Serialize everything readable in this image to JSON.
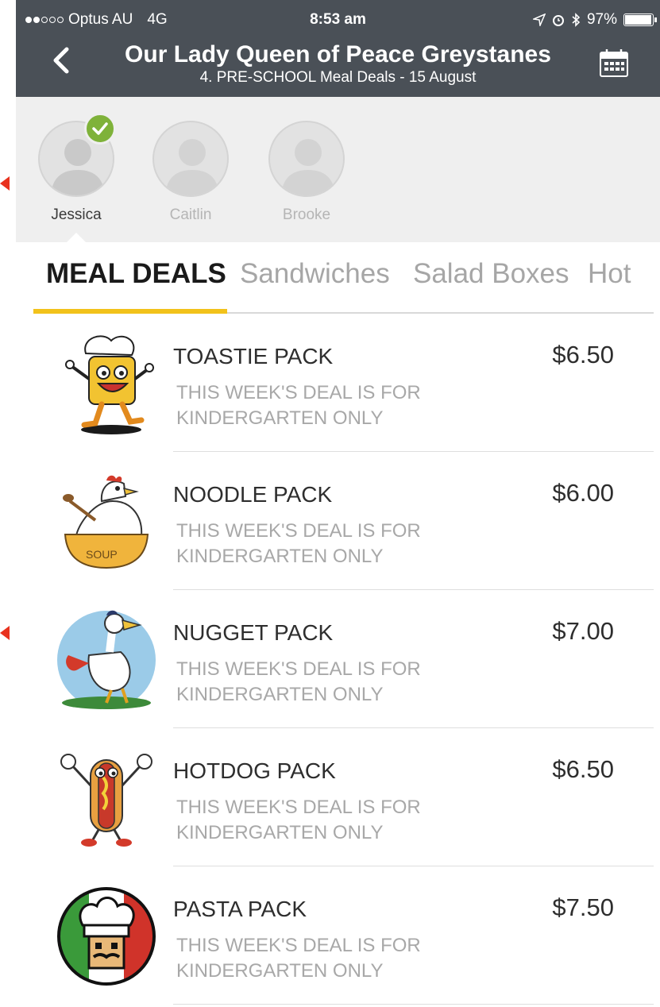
{
  "status_bar": {
    "carrier": "Optus AU",
    "network": "4G",
    "time": "8:53 am",
    "battery": "97%",
    "battery_level": 0.97
  },
  "header": {
    "title": "Our Lady Queen of Peace Greystanes",
    "subtitle": "4. PRE-SCHOOL Meal Deals - 15 August",
    "back_icon": "chevron-left-icon",
    "calendar_icon": "calendar-icon"
  },
  "children": [
    {
      "name": "Jessica",
      "selected": true
    },
    {
      "name": "Caitlin",
      "selected": false
    },
    {
      "name": "Brooke",
      "selected": false
    }
  ],
  "tabs": [
    {
      "label": "MEAL DEALS",
      "active": true
    },
    {
      "label": "Sandwiches",
      "active": false
    },
    {
      "label": "Salad Boxes",
      "active": false
    },
    {
      "label": "Hot",
      "active": false
    }
  ],
  "items": [
    {
      "name": "TOASTIE PACK",
      "price": "$6.50",
      "desc": "THIS WEEK'S DEAL IS FOR KINDERGARTEN ONLY",
      "image": "toastie-mascot"
    },
    {
      "name": "NOODLE PACK",
      "price": "$6.00",
      "desc": "THIS WEEK'S DEAL IS FOR KINDERGARTEN ONLY",
      "image": "chicken-soup-mascot"
    },
    {
      "name": "NUGGET PACK",
      "price": "$7.00",
      "desc": "THIS WEEK'S DEAL IS FOR KINDERGARTEN ONLY",
      "image": "rooster-mascot"
    },
    {
      "name": "HOTDOG PACK",
      "price": "$6.50",
      "desc": "THIS WEEK'S DEAL IS FOR KINDERGARTEN ONLY",
      "image": "hotdog-mascot"
    },
    {
      "name": "PASTA PACK",
      "price": "$7.50",
      "desc": "THIS WEEK'S DEAL IS FOR KINDERGARTEN ONLY",
      "image": "italian-chef-mascot"
    }
  ],
  "colors": {
    "header_bg": "#4a5057",
    "tab_underline": "#f2c21b",
    "check_green": "#7fb23a",
    "annotation_arrow": "#e8321e"
  }
}
